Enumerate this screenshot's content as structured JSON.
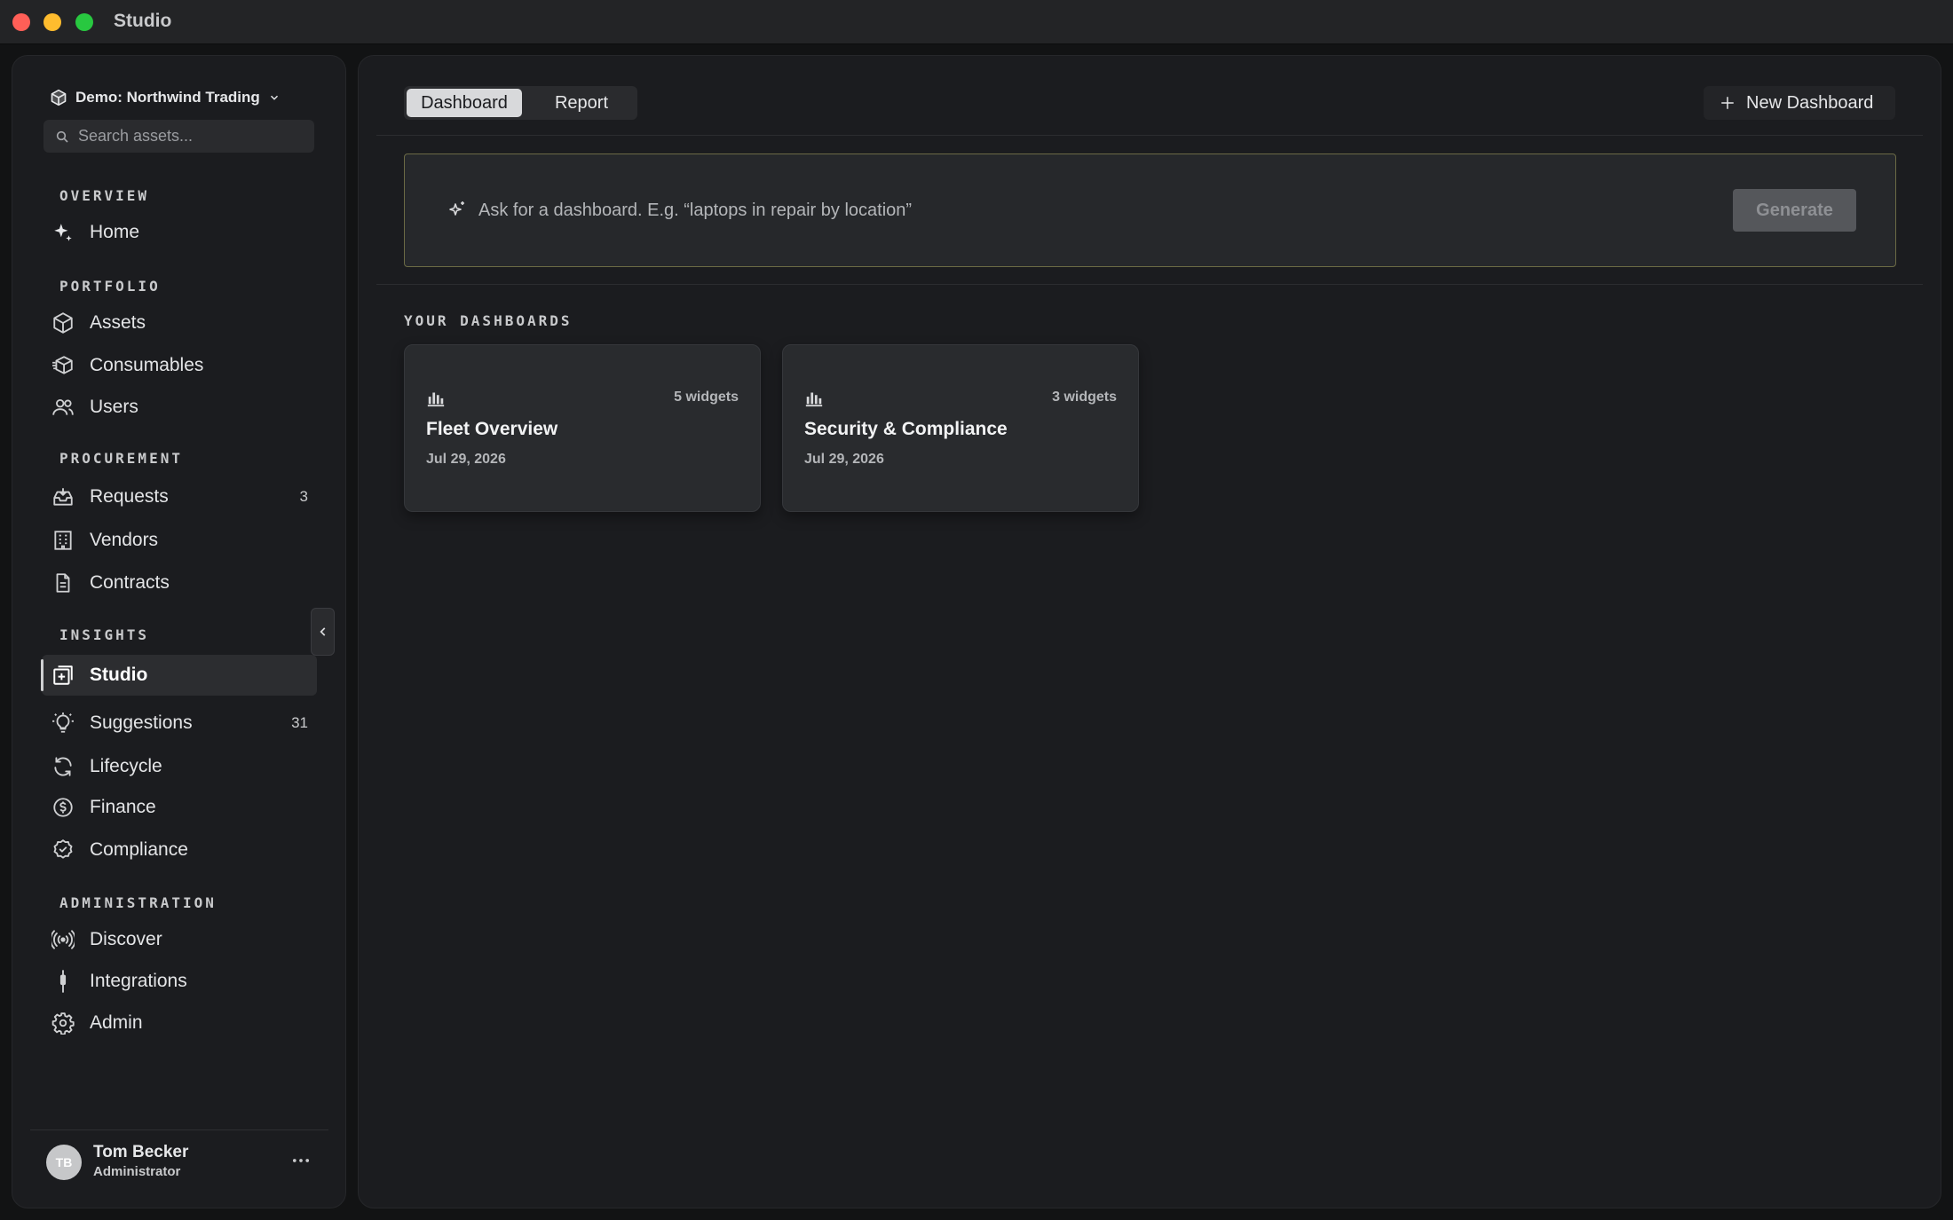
{
  "window": {
    "title": "Studio"
  },
  "sidebar": {
    "workspace": "Demo: Northwind Trading",
    "search_placeholder": "Search assets...",
    "sections": {
      "overview": "OVERVIEW",
      "portfolio": "PORTFOLIO",
      "procurement": "PROCUREMENT",
      "insights": "INSIGHTS",
      "administration": "ADMINISTRATION"
    },
    "items": {
      "home": {
        "label": "Home",
        "icon": "sparkle-icon"
      },
      "assets": {
        "label": "Assets",
        "icon": "cube-icon"
      },
      "consumables": {
        "label": "Consumables",
        "icon": "boxes-icon"
      },
      "users": {
        "label": "Users",
        "icon": "users-icon"
      },
      "requests": {
        "label": "Requests",
        "count": "3",
        "icon": "inbox-icon"
      },
      "vendors": {
        "label": "Vendors",
        "icon": "building-icon"
      },
      "contracts": {
        "label": "Contracts",
        "icon": "document-icon"
      },
      "studio": {
        "label": "Studio",
        "icon": "studio-icon",
        "active": true
      },
      "suggestions": {
        "label": "Suggestions",
        "count": "31",
        "icon": "lightbulb-icon"
      },
      "lifecycle": {
        "label": "Lifecycle",
        "icon": "refresh-icon"
      },
      "finance": {
        "label": "Finance",
        "icon": "dollar-icon"
      },
      "compliance": {
        "label": "Compliance",
        "icon": "badge-check-icon"
      },
      "discover": {
        "label": "Discover",
        "icon": "radar-icon"
      },
      "integrations": {
        "label": "Integrations",
        "icon": "plug-icon"
      },
      "admin": {
        "label": "Admin",
        "icon": "gear-icon"
      }
    },
    "user": {
      "initials": "TB",
      "name": "Tom Becker",
      "role": "Administrator"
    }
  },
  "main": {
    "tabs": {
      "dashboard": "Dashboard",
      "report": "Report",
      "selected": "Dashboard"
    },
    "new_dashboard_label": "New Dashboard",
    "prompt": {
      "placeholder": "Ask for a dashboard. E.g. “laptops in repair by location”",
      "generate_label": "Generate"
    },
    "dashboards_heading": "YOUR DASHBOARDS",
    "dashboards": [
      {
        "title": "Fleet Overview",
        "widgets": "5 widgets",
        "date": "Jul 29, 2026"
      },
      {
        "title": "Security & Compliance",
        "widgets": "3 widgets",
        "date": "Jul 29, 2026"
      }
    ]
  },
  "colors": {
    "background": "#121314",
    "panel": "#1b1c1f",
    "prompt_border": "#6b6a45",
    "traffic_red": "#ff5f57",
    "traffic_yellow": "#febc2e",
    "traffic_green": "#28c840"
  }
}
